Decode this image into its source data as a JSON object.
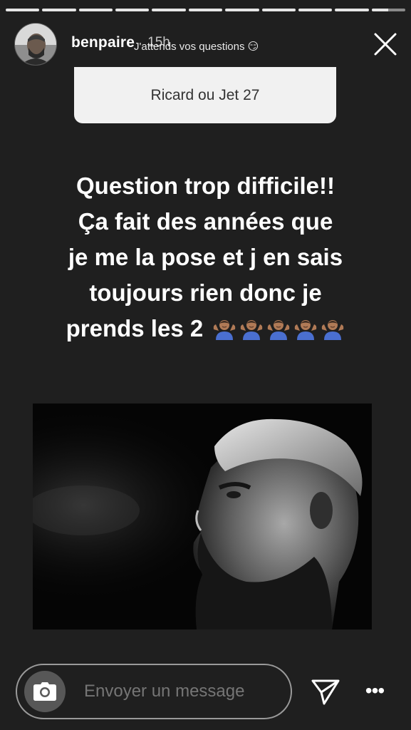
{
  "progress": {
    "segments": [
      1,
      1,
      1,
      1,
      1,
      1,
      1,
      1,
      1,
      1,
      0.5
    ],
    "fill_color": "#e6e6e6",
    "track_color": "#8a8a8a"
  },
  "header": {
    "username": "benpaire",
    "time": "15h",
    "close_icon": "close-icon"
  },
  "question_sticker": {
    "prompt": "J'attends vos questions 😏",
    "answer": "Ricard ou Jet 27"
  },
  "caption": {
    "lines": [
      "Question trop difficile!!",
      "Ça fait des années que",
      "je me la pose et j en sais",
      "toujours rien donc je",
      "prends les 2"
    ],
    "emoji_name": "person-shrugging-emoji",
    "emoji_count": 5
  },
  "footer": {
    "placeholder": "Envoyer un message",
    "camera_icon": "camera-icon",
    "send_icon": "send-icon",
    "more_icon": "more-icon",
    "more_glyph": "•••"
  }
}
